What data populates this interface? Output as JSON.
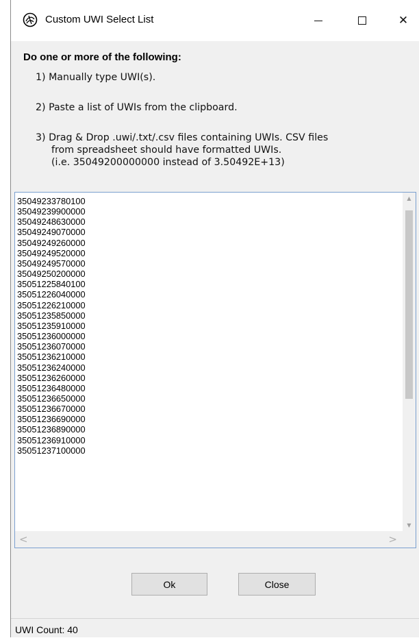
{
  "window": {
    "title": "Custom UWI Select List",
    "close_glyph": "✕"
  },
  "instructions": {
    "heading": "Do one or more of the following:",
    "step1": "1) Manually type UWI(s).",
    "step2": "2) Paste a list of UWIs from the clipboard.",
    "step3_line1": "3) Drag & Drop .uwi/.txt/.csv files containing UWIs. CSV files",
    "step3_line2": "from spreadsheet should have formatted UWIs.",
    "step3_line3": "(i.e. 35049200000000 instead of 3.50492E+13)"
  },
  "uwi_list": [
    "35049233780100",
    "35049239900000",
    "35049248630000",
    "35049249070000",
    "35049249260000",
    "35049249520000",
    "35049249570000",
    "35049250200000",
    "35051225840100",
    "35051226040000",
    "35051226210000",
    "35051235850000",
    "35051235910000",
    "35051236000000",
    "35051236070000",
    "35051236210000",
    "35051236240000",
    "35051236260000",
    "35051236480000",
    "35051236650000",
    "35051236670000",
    "35051236690000",
    "35051236890000",
    "35051236910000",
    "35051237100000"
  ],
  "scrollbars": {
    "left_arrow": "<",
    "right_arrow": ">"
  },
  "buttons": {
    "ok": "Ok",
    "close": "Close"
  },
  "status": {
    "text": "UWI Count: 40"
  }
}
